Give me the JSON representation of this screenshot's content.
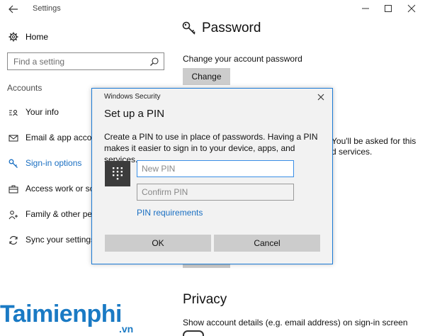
{
  "window": {
    "title": "Settings"
  },
  "sidebar": {
    "home_label": "Home",
    "search_placeholder": "Find a setting",
    "section_label": "Accounts",
    "items": [
      {
        "label": "Your info",
        "icon": "person-card-icon"
      },
      {
        "label": "Email & app accou",
        "icon": "mail-icon"
      },
      {
        "label": "Sign-in options",
        "icon": "key-icon",
        "active": true
      },
      {
        "label": "Access work or sch",
        "icon": "briefcase-icon"
      },
      {
        "label": "Family & other peo",
        "icon": "people-icon"
      },
      {
        "label": "Sync your settings",
        "icon": "sync-icon"
      }
    ]
  },
  "main": {
    "password_title": "Password",
    "password_subtitle": "Change your account password",
    "change_label": "Change",
    "pin_partial_line1": "You'll be asked for this",
    "pin_partial_line2": "d services.",
    "privacy_title": "Privacy",
    "privacy_subtitle": "Show account details (e.g. email address) on sign-in screen"
  },
  "dialog": {
    "window_title": "Windows Security",
    "heading": "Set up a PIN",
    "description": "Create a PIN to use in place of passwords. Having a PIN makes it easier to sign in to your device, apps, and services.",
    "new_pin_placeholder": "New PIN",
    "confirm_pin_placeholder": "Confirm PIN",
    "requirements_link": "PIN requirements",
    "ok_label": "OK",
    "cancel_label": "Cancel"
  },
  "watermark": {
    "brand": "Taimienphi",
    "suffix": ".vn"
  },
  "colors": {
    "accent": "#1a6fc2",
    "dialog_border": "#1c7bd6",
    "button_gray": "#cccccc"
  }
}
